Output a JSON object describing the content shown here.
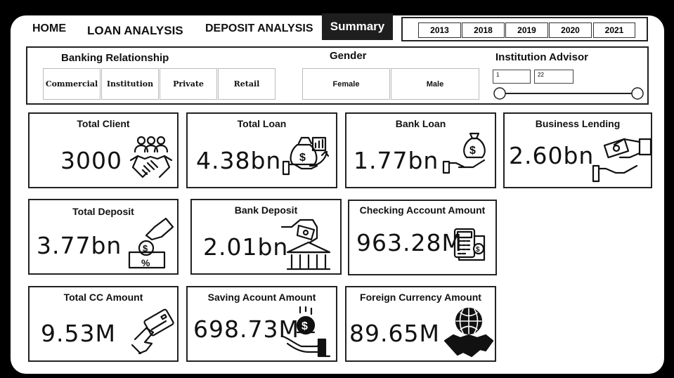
{
  "nav": {
    "home": "HOME",
    "loan_analysis": "LOAN ANALYSIS",
    "deposit_analysis": "DEPOSIT ANALYSIS",
    "summary": "Summary"
  },
  "years": [
    "2013",
    "2018",
    "2019",
    "2020",
    "2021"
  ],
  "filters": {
    "banking_relationship": {
      "title": "Banking Relationship",
      "options": [
        "Commercial",
        "Institution",
        "Private",
        "Retail"
      ]
    },
    "gender": {
      "title": "Gender",
      "options": [
        "Female",
        "Male"
      ]
    },
    "institution_advisor": {
      "title": "Institution Advisor",
      "min": "1",
      "max": "22"
    }
  },
  "cards": [
    {
      "title": "Total Client",
      "value": "3000",
      "icon": "handshake-people-icon"
    },
    {
      "title": "Total Loan",
      "value": "4.38bn",
      "icon": "money-bag-chart-icon"
    },
    {
      "title": "Bank Loan",
      "value": "1.77bn",
      "icon": "hand-money-bag-icon"
    },
    {
      "title": "Business Lending",
      "value": "2.60bn",
      "icon": "hand-cash-icon"
    },
    {
      "title": "Total Deposit",
      "value": "3.77bn",
      "icon": "deposit-coin-icon"
    },
    {
      "title": "Bank Deposit",
      "value": "2.01bn",
      "icon": "bank-deposit-icon"
    },
    {
      "title": "Checking Account Amount",
      "value": "963.28M",
      "icon": "calculator-receipt-icon"
    },
    {
      "title": "Total CC Amount",
      "value": "9.53M",
      "icon": "hand-credit-card-icon"
    },
    {
      "title": "Saving Acount Amount",
      "value": "698.73M",
      "icon": "hand-coin-icon"
    },
    {
      "title": "Foreign Currency Amount",
      "value": "89.65M",
      "icon": "globe-handshake-icon"
    }
  ]
}
